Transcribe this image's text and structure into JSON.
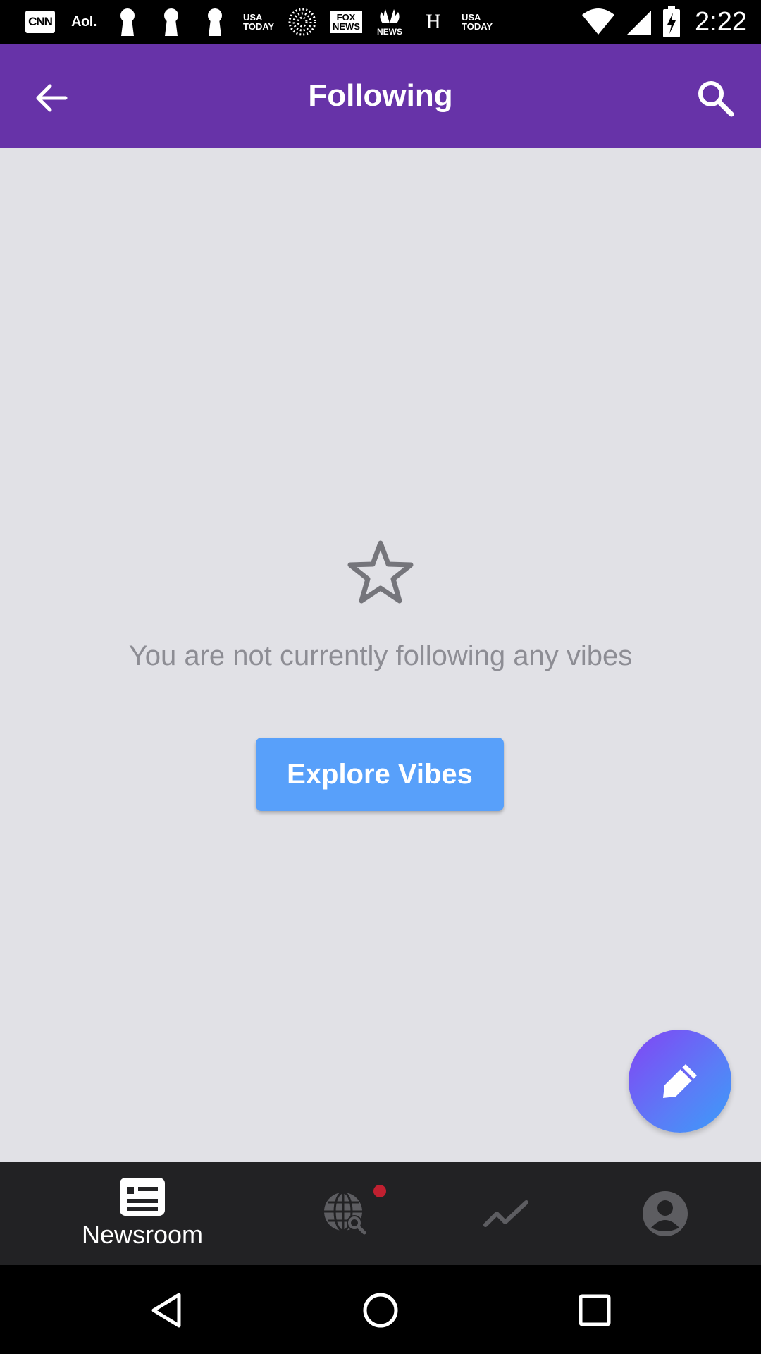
{
  "status_bar": {
    "notification_logos": [
      "CNN",
      "Aol.",
      "USA TODAY",
      "FOX NEWS",
      "NBC NEWS",
      "H",
      "USA TODAY"
    ],
    "time": "2:22"
  },
  "app_bar": {
    "title": "Following",
    "back_icon": "arrow-left-icon",
    "search_icon": "search-icon"
  },
  "empty_state": {
    "icon": "star-outline-icon",
    "message": "You are not currently following any vibes",
    "button_label": "Explore Vibes"
  },
  "fab": {
    "icon": "pencil-icon"
  },
  "bottom_nav": {
    "items": [
      {
        "label": "Newsroom",
        "icon": "newsroom-icon",
        "active": true
      },
      {
        "label": "",
        "icon": "globe-search-icon",
        "has_notification": true
      },
      {
        "label": "",
        "icon": "trending-icon"
      },
      {
        "label": "",
        "icon": "profile-icon"
      }
    ]
  },
  "colors": {
    "app_bar": "#6733a8",
    "background": "#e1e1e6",
    "button": "#58a0fa",
    "bottom_nav": "#222224",
    "notification_dot": "#c02030"
  }
}
